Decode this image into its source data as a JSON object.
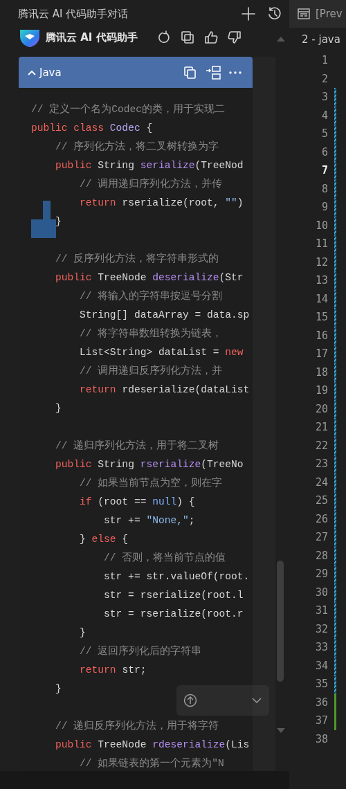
{
  "panel": {
    "title": "腾讯云 AI 代码助手对话"
  },
  "assistant": {
    "name": "腾讯云 AI 代码助手"
  },
  "code_block": {
    "language": "Java",
    "expanded": true,
    "lines": [
      {
        "kind": "code",
        "tokens": [
          {
            "kind": "comment",
            "text": "// 定义一个名为Codec的类，用于实现二"
          }
        ]
      },
      {
        "kind": "code",
        "tokens": [
          {
            "kind": "keyword",
            "text": "public class "
          },
          {
            "kind": "classname",
            "text": "Codec"
          },
          {
            "kind": "plain",
            "text": " {"
          }
        ]
      },
      {
        "kind": "code",
        "tokens": [
          {
            "kind": "comment",
            "text": "    // 序列化方法，将二叉树转换为字"
          }
        ]
      },
      {
        "kind": "code",
        "tokens": [
          {
            "kind": "keyword",
            "text": "    public "
          },
          {
            "kind": "plain",
            "text": "String "
          },
          {
            "kind": "method",
            "text": "serialize"
          },
          {
            "kind": "plain",
            "text": "(TreeNod"
          }
        ]
      },
      {
        "kind": "code",
        "tokens": [
          {
            "kind": "comment",
            "text": "        // 调用递归序列化方法，并传"
          }
        ]
      },
      {
        "kind": "code",
        "tokens": [
          {
            "kind": "keyword",
            "text": "        return "
          },
          {
            "kind": "plain",
            "text": "rserialize(root, "
          },
          {
            "kind": "string",
            "text": "\"\""
          },
          {
            "kind": "plain",
            "text": ")"
          }
        ]
      },
      {
        "kind": "code",
        "tokens": [
          {
            "kind": "plain",
            "text": "    }"
          }
        ]
      },
      {
        "kind": "blank"
      },
      {
        "kind": "code",
        "tokens": [
          {
            "kind": "comment",
            "text": "    // 反序列化方法，将字符串形式的"
          }
        ]
      },
      {
        "kind": "code",
        "tokens": [
          {
            "kind": "keyword",
            "text": "    public "
          },
          {
            "kind": "plain",
            "text": "TreeNode "
          },
          {
            "kind": "method",
            "text": "deserialize"
          },
          {
            "kind": "plain",
            "text": "(Str"
          }
        ]
      },
      {
        "kind": "code",
        "tokens": [
          {
            "kind": "comment",
            "text": "        // 将输入的字符串按逗号分割"
          }
        ]
      },
      {
        "kind": "code",
        "tokens": [
          {
            "kind": "plain",
            "text": "        String[] dataArray = data.sp"
          }
        ]
      },
      {
        "kind": "code",
        "tokens": [
          {
            "kind": "comment",
            "text": "        // 将字符串数组转换为链表，"
          }
        ]
      },
      {
        "kind": "code",
        "tokens": [
          {
            "kind": "plain",
            "text": "        List<String> dataList = "
          },
          {
            "kind": "keyword",
            "text": "new"
          }
        ]
      },
      {
        "kind": "code",
        "tokens": [
          {
            "kind": "comment",
            "text": "        // 调用递归反序列化方法，并"
          }
        ]
      },
      {
        "kind": "code",
        "tokens": [
          {
            "kind": "keyword",
            "text": "        return "
          },
          {
            "kind": "plain",
            "text": "rdeserialize(dataList"
          }
        ]
      },
      {
        "kind": "code",
        "tokens": [
          {
            "kind": "plain",
            "text": "    }"
          }
        ]
      },
      {
        "kind": "blank"
      },
      {
        "kind": "code",
        "tokens": [
          {
            "kind": "comment",
            "text": "    // 递归序列化方法，用于将二叉树"
          }
        ]
      },
      {
        "kind": "code",
        "tokens": [
          {
            "kind": "keyword",
            "text": "    public "
          },
          {
            "kind": "plain",
            "text": "String "
          },
          {
            "kind": "method",
            "text": "rserialize"
          },
          {
            "kind": "plain",
            "text": "(TreeNo"
          }
        ]
      },
      {
        "kind": "code",
        "tokens": [
          {
            "kind": "comment",
            "text": "        // 如果当前节点为空，则在字"
          }
        ]
      },
      {
        "kind": "code",
        "tokens": [
          {
            "kind": "keyword",
            "text": "        if "
          },
          {
            "kind": "plain",
            "text": "(root == "
          },
          {
            "kind": "literal",
            "text": "null"
          },
          {
            "kind": "plain",
            "text": ") {"
          }
        ]
      },
      {
        "kind": "code",
        "tokens": [
          {
            "kind": "plain",
            "text": "            str += "
          },
          {
            "kind": "string",
            "text": "\"None,\""
          },
          {
            "kind": "plain",
            "text": ";"
          }
        ]
      },
      {
        "kind": "code",
        "tokens": [
          {
            "kind": "plain",
            "text": "        } "
          },
          {
            "kind": "keyword",
            "text": "else"
          },
          {
            "kind": "plain",
            "text": " {"
          }
        ]
      },
      {
        "kind": "code",
        "tokens": [
          {
            "kind": "comment",
            "text": "            // 否则，将当前节点的值"
          }
        ]
      },
      {
        "kind": "code",
        "tokens": [
          {
            "kind": "plain",
            "text": "            str += str.valueOf(root."
          }
        ]
      },
      {
        "kind": "code",
        "tokens": [
          {
            "kind": "plain",
            "text": "            str = rserialize(root.l"
          }
        ]
      },
      {
        "kind": "code",
        "tokens": [
          {
            "kind": "plain",
            "text": "            str = rserialize(root.r"
          }
        ]
      },
      {
        "kind": "code",
        "tokens": [
          {
            "kind": "plain",
            "text": "        }"
          }
        ]
      },
      {
        "kind": "code",
        "tokens": [
          {
            "kind": "comment",
            "text": "        // 返回序列化后的字符串"
          }
        ]
      },
      {
        "kind": "code",
        "tokens": [
          {
            "kind": "keyword",
            "text": "        return "
          },
          {
            "kind": "plain",
            "text": "str;"
          }
        ]
      },
      {
        "kind": "code",
        "tokens": [
          {
            "kind": "plain",
            "text": "    }"
          }
        ]
      },
      {
        "kind": "blank"
      },
      {
        "kind": "code",
        "tokens": [
          {
            "kind": "comment",
            "text": "    // 递归反序列化方法，用于将字符"
          }
        ]
      },
      {
        "kind": "code",
        "tokens": [
          {
            "kind": "keyword",
            "text": "    public "
          },
          {
            "kind": "plain",
            "text": "TreeNode "
          },
          {
            "kind": "method",
            "text": "rdeserialize"
          },
          {
            "kind": "plain",
            "text": "(Lis"
          }
        ]
      },
      {
        "kind": "code",
        "tokens": [
          {
            "kind": "comment",
            "text": "        // 如果链表的第一个元素为\"N"
          }
        ]
      }
    ]
  },
  "editor": {
    "tab": "[Prev",
    "breadcrumb": "2 - java",
    "line_numbers": [
      {
        "number": "1",
        "current": false,
        "kind": "plain"
      },
      {
        "number": "2",
        "current": false,
        "kind": "plain"
      },
      {
        "number": "3",
        "current": false,
        "kind": "modified"
      },
      {
        "number": "4",
        "current": false,
        "kind": "modified"
      },
      {
        "number": "5",
        "current": false,
        "kind": "modified"
      },
      {
        "number": "6",
        "current": false,
        "kind": "modified"
      },
      {
        "number": "7",
        "current": true,
        "kind": "modified"
      },
      {
        "number": "8",
        "current": false,
        "kind": "modified"
      },
      {
        "number": "9",
        "current": false,
        "kind": "modified"
      },
      {
        "number": "10",
        "current": false,
        "kind": "modified"
      },
      {
        "number": "11",
        "current": false,
        "kind": "modified"
      },
      {
        "number": "12",
        "current": false,
        "kind": "modified"
      },
      {
        "number": "13",
        "current": false,
        "kind": "modified"
      },
      {
        "number": "14",
        "current": false,
        "kind": "modified"
      },
      {
        "number": "15",
        "current": false,
        "kind": "modified"
      },
      {
        "number": "16",
        "current": false,
        "kind": "modified"
      },
      {
        "number": "17",
        "current": false,
        "kind": "modified"
      },
      {
        "number": "18",
        "current": false,
        "kind": "modified"
      },
      {
        "number": "19",
        "current": false,
        "kind": "modified"
      },
      {
        "number": "20",
        "current": false,
        "kind": "modified"
      },
      {
        "number": "21",
        "current": false,
        "kind": "modified"
      },
      {
        "number": "22",
        "current": false,
        "kind": "modified"
      },
      {
        "number": "23",
        "current": false,
        "kind": "modified"
      },
      {
        "number": "24",
        "current": false,
        "kind": "modified"
      },
      {
        "number": "25",
        "current": false,
        "kind": "modified"
      },
      {
        "number": "26",
        "current": false,
        "kind": "modified"
      },
      {
        "number": "27",
        "current": false,
        "kind": "modified"
      },
      {
        "number": "28",
        "current": false,
        "kind": "modified"
      },
      {
        "number": "29",
        "current": false,
        "kind": "modified"
      },
      {
        "number": "30",
        "current": false,
        "kind": "modified"
      },
      {
        "number": "31",
        "current": false,
        "kind": "modified"
      },
      {
        "number": "32",
        "current": false,
        "kind": "modified"
      },
      {
        "number": "33",
        "current": false,
        "kind": "modified"
      },
      {
        "number": "34",
        "current": false,
        "kind": "modified"
      },
      {
        "number": "35",
        "current": false,
        "kind": "modified"
      },
      {
        "number": "36",
        "current": false,
        "kind": "added"
      },
      {
        "number": "37",
        "current": false,
        "kind": "added"
      },
      {
        "number": "38",
        "current": false,
        "kind": "plain"
      }
    ]
  }
}
